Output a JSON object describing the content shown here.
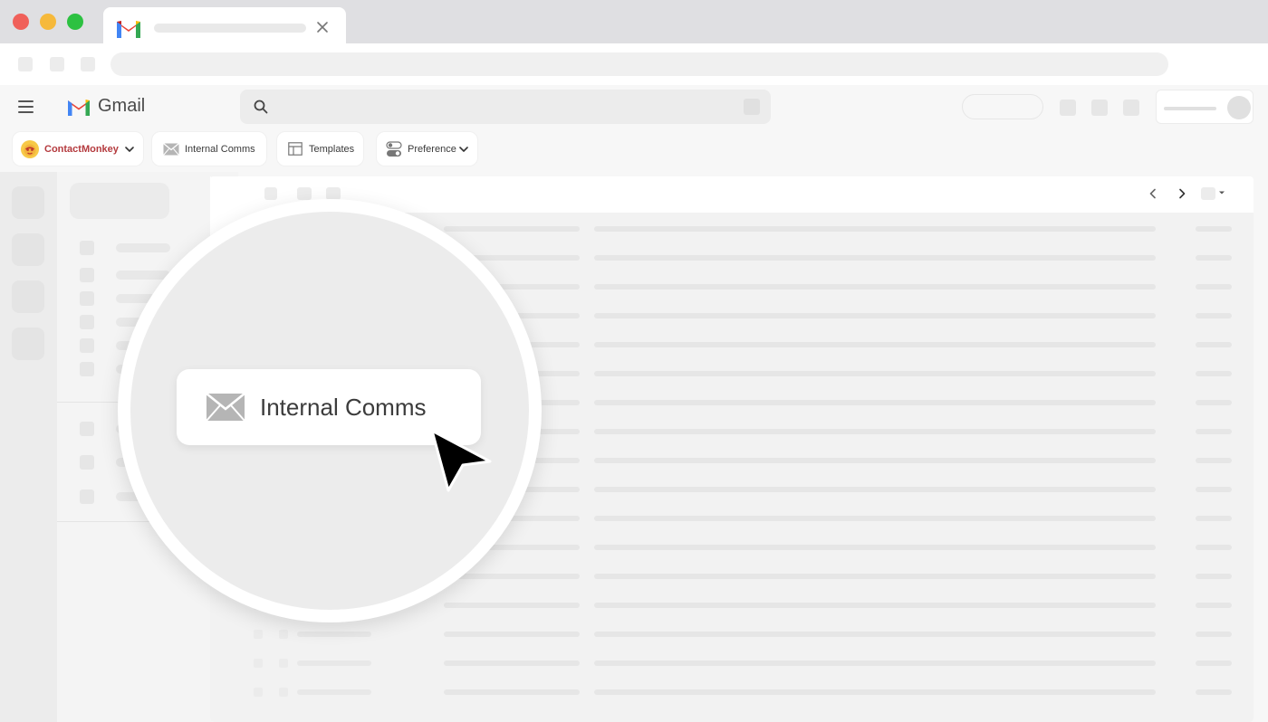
{
  "gmail": {
    "app_name": "Gmail"
  },
  "addon_toolbar": {
    "main_label": "ContactMonkey",
    "internal_comms_label": "Internal Comms",
    "templates_label": "Templates",
    "preference_label": "Preference"
  },
  "callout": {
    "zoomed_label": "Internal Comms"
  },
  "icons": {
    "close": "close-icon",
    "menu": "hamburger-menu-icon",
    "logo": "gmail-logo",
    "search": "search-icon",
    "addon_logo": "contactmonkey-logo",
    "envelope": "envelope-icon",
    "templates": "layout-template-icon",
    "preference": "toggle-switch-icon",
    "chevron": "chevron-down-icon",
    "prev": "chevron-left-icon",
    "next": "chevron-right-icon",
    "cursor": "mouse-cursor-icon"
  },
  "colors": {
    "addon_brand": "#b43a3e",
    "gmail_red": "#ea4335",
    "gmail_blue": "#4285f4",
    "gmail_green": "#34a853",
    "gmail_yellow": "#fbbc04"
  }
}
